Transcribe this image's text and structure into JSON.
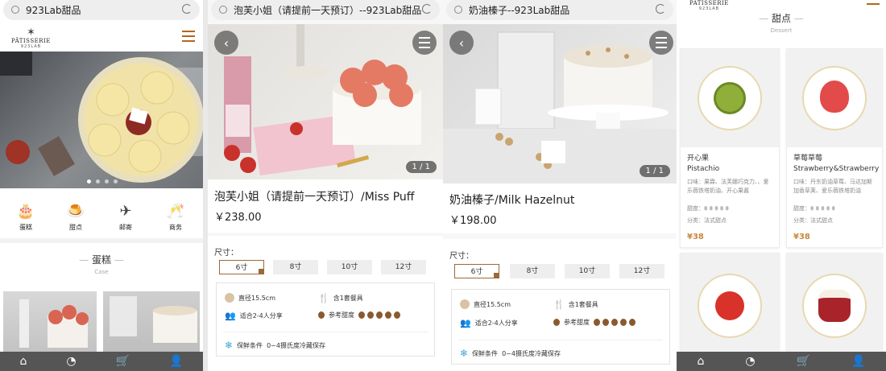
{
  "browser": {
    "url1": "923Lab甜品",
    "url2": "泡芙小姐（请提前一天预订）--923Lab甜品",
    "url3": "奶油榛子--923Lab甜品"
  },
  "brand": {
    "name": "PÂTISSERIE",
    "sub": "923LAB"
  },
  "carousel": {
    "dots": 4
  },
  "categories": [
    {
      "icon": "cake-icon",
      "glyph": "🎂",
      "label": "蛋糕"
    },
    {
      "icon": "dessert-icon",
      "glyph": "🍮",
      "label": "甜点"
    },
    {
      "icon": "mail-icon",
      "glyph": "✈",
      "label": "邮寄"
    },
    {
      "icon": "business-icon",
      "glyph": "🥂",
      "label": "商务"
    }
  ],
  "section_cake": {
    "title": "蛋糕",
    "subtitle": "Case"
  },
  "product1": {
    "title": "泡芙小姐（请提前一天预订）/Miss Puff",
    "price": "￥238.00",
    "pager": "1 / 1"
  },
  "product2": {
    "title": "奶油榛子/Milk Hazelnut",
    "price": "￥198.00",
    "pager": "1 / 1"
  },
  "size_label": "尺寸：",
  "sizes": [
    "6寸",
    "8寸",
    "10寸",
    "12寸"
  ],
  "info": {
    "diameter": "直径15.5cm",
    "tableware": "含1套餐具",
    "serves": "适合2-4人分享",
    "sweetness": "参考甜度",
    "storage_label": "保鲜条件",
    "storage": "0~4摄氏度冷藏保存"
  },
  "dessert_section": {
    "title": "甜点",
    "subtitle": "Dessert"
  },
  "desserts": [
    {
      "name_cn": "开心果",
      "name_en": "Pistachio",
      "desc": "口味：果霖、法芙娜巧克力、、爱乐薇铁塔奶油、开心果酱",
      "sweet": "甜度：",
      "cat": "分类：法式甜点",
      "price": "¥38"
    },
    {
      "name_cn": "草莓草莓",
      "name_en": "Strawberry&Strawberry",
      "desc": "口味：丹东奶油草莓、马达加斯加香草荚、爱乐薇铁塔奶油",
      "sweet": "甜度：",
      "cat": "分类：法式甜点",
      "price": "¥38"
    }
  ],
  "tabbar": [
    "🏠",
    "◔",
    "🛒",
    "👤"
  ],
  "colors": {
    "accent": "#9a6a3a",
    "price": "#c8883e"
  }
}
